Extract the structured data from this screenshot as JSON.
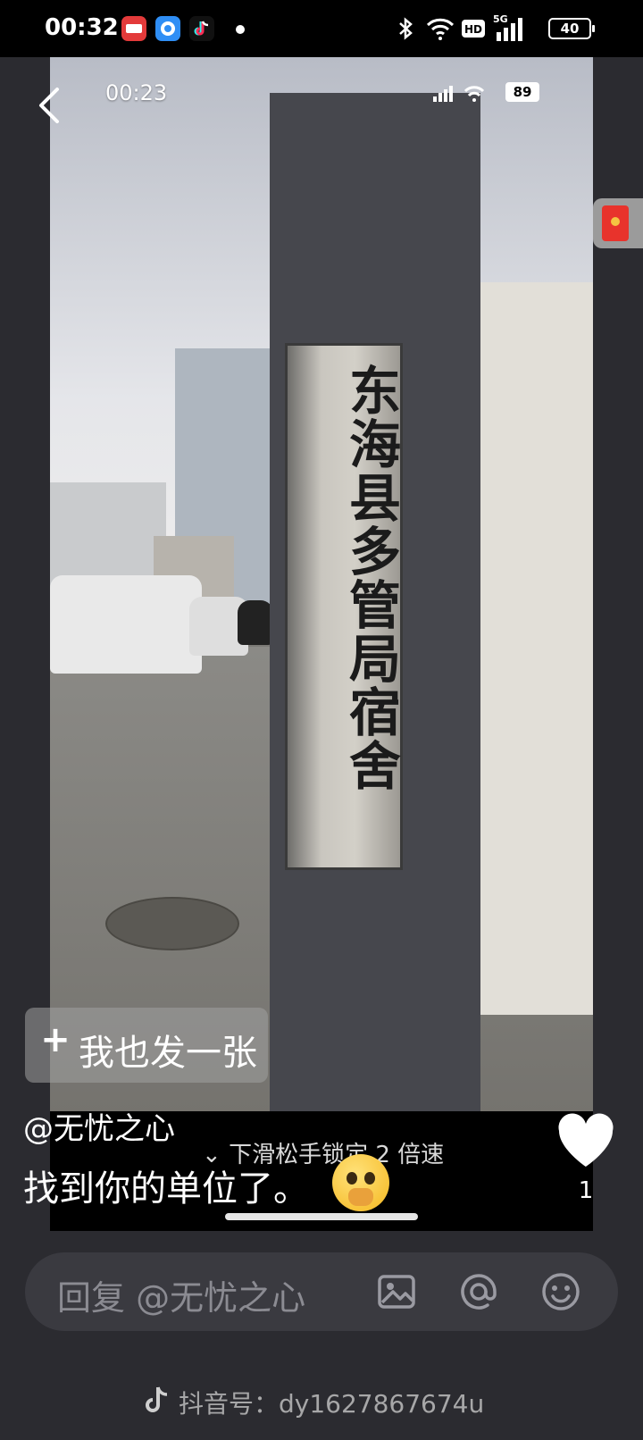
{
  "status_bar": {
    "time": "00:32",
    "battery": "40",
    "app_icons": [
      "toutiao-icon",
      "browser-icon",
      "douyin-icon"
    ],
    "right_icons": [
      "bluetooth-icon",
      "wifi-icon",
      "hd-icon",
      "5g-signal-icon"
    ]
  },
  "video": {
    "inner_time": "00:23",
    "inner_battery": "89",
    "sign_text": "东海县多管局宿舍",
    "post_button_label": "我也发一张",
    "author": "@无忧之心",
    "caption": "找到你的单位了。",
    "caption_emoji": "crying-face-emoji",
    "hint": "下滑松手锁定 2 倍速",
    "like_count": "1"
  },
  "reply_bar": {
    "placeholder": "回复 @无忧之心",
    "icons": [
      "image-icon",
      "at-icon",
      "emoji-icon"
    ]
  },
  "watermark": {
    "text": "抖音号：dy1627867674u"
  },
  "colors": {
    "background": "#2b2b30",
    "reply_bar": "#3a3a40",
    "red_packet": "#e8332c"
  }
}
